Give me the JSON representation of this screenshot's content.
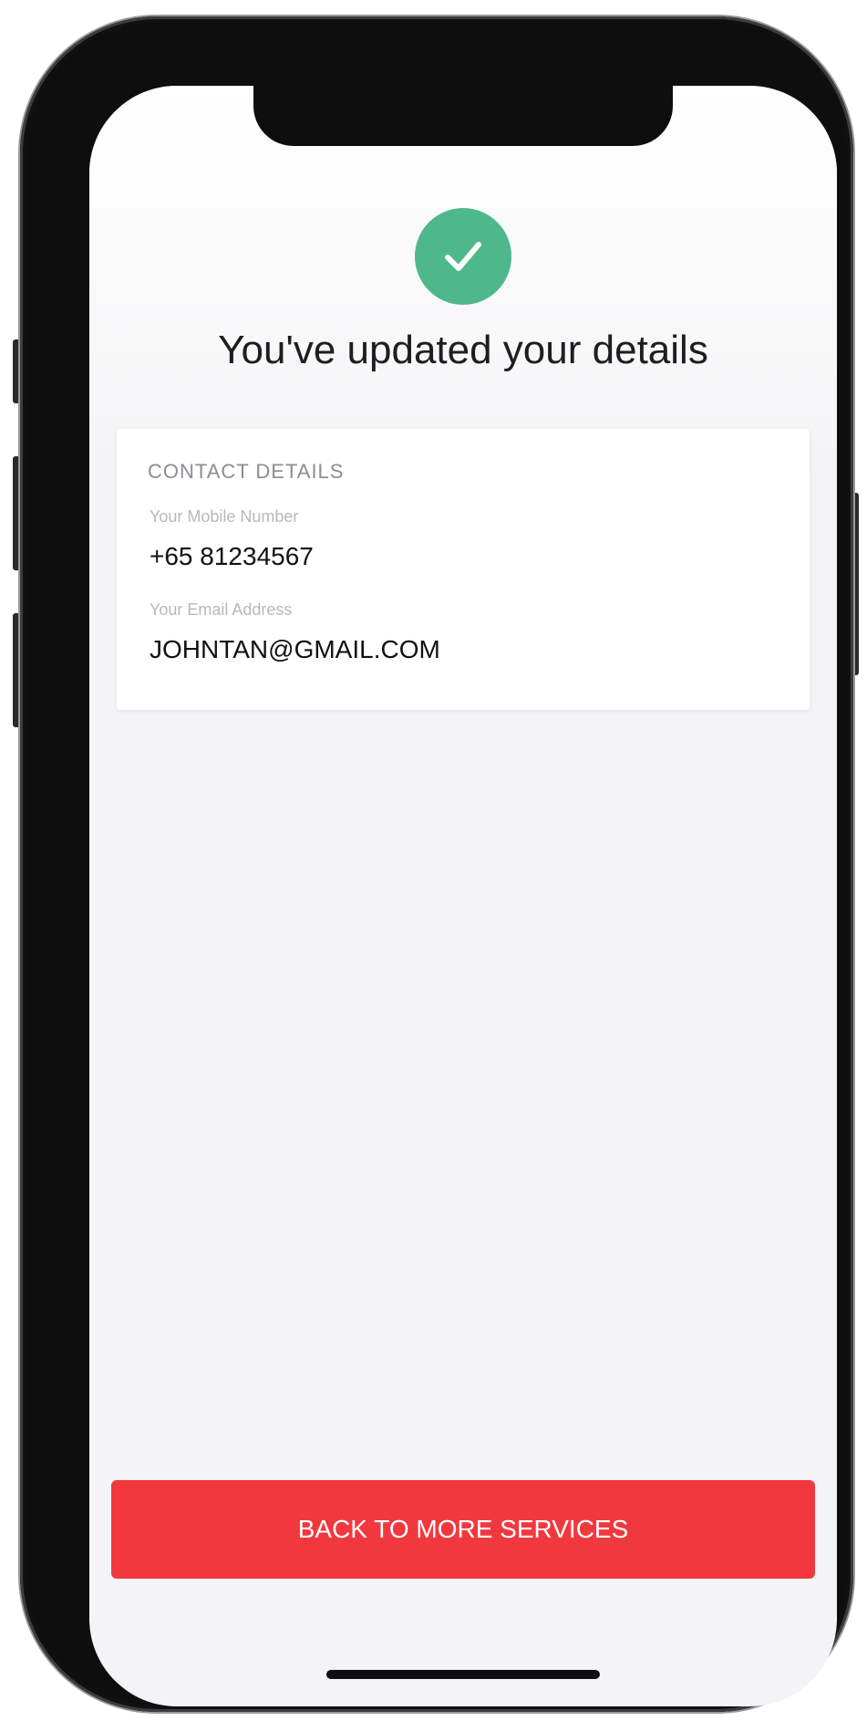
{
  "screen": {
    "success_icon": "checkmark-icon",
    "title": "You've updated your details"
  },
  "contact_card": {
    "header": "CONTACT DETAILS",
    "mobile_label": "Your Mobile Number",
    "mobile_value": "+65 81234567",
    "email_label": "Your Email Address",
    "email_value": "JOHNTAN@GMAIL.COM"
  },
  "actions": {
    "back_button_label": "BACK TO MORE SERVICES"
  },
  "colors": {
    "success": "#4eb88b",
    "primary_button": "#f2383f",
    "background": "#f4f4f6"
  }
}
